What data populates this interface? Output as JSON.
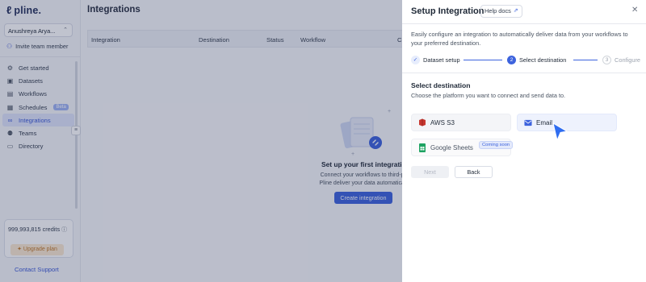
{
  "brand": {
    "logo_text": "pline."
  },
  "sidebar": {
    "account_name": "Anushreya Arya...",
    "invite_label": "Invite team member",
    "items": [
      {
        "label": "Get started",
        "icon": "rocket-icon"
      },
      {
        "label": "Datasets",
        "icon": "datasets-icon"
      },
      {
        "label": "Workflows",
        "icon": "workflows-icon"
      },
      {
        "label": "Schedules",
        "icon": "calendar-icon",
        "badge": "Beta"
      },
      {
        "label": "Integrations",
        "icon": "link-icon",
        "active": true
      },
      {
        "label": "Teams",
        "icon": "users-icon"
      },
      {
        "label": "Directory",
        "icon": "folder-icon"
      }
    ],
    "credits": "999,993,815 credits",
    "upgrade_label": "Upgrade plan",
    "support_label": "Contact Support"
  },
  "main": {
    "title": "Integrations",
    "columns": [
      "Integration",
      "Destination",
      "Status",
      "Workflow",
      "C"
    ],
    "empty_title": "Set up your first integratio",
    "empty_line1": "Connect your workflows to third-party plat",
    "empty_line2": "Pline deliver your data automatically and c",
    "create_label": "Create integration"
  },
  "drawer": {
    "title": "Setup Integration",
    "help_label": "Help docs",
    "intro": "Easily configure an integration to automatically deliver data from your workflows to your preferred destination.",
    "steps": [
      {
        "num": "✓",
        "label": "Dataset setup",
        "state": "done"
      },
      {
        "num": "2",
        "label": "Select destination",
        "state": "active"
      },
      {
        "num": "3",
        "label": "Configure",
        "state": "upcoming"
      }
    ],
    "section_title": "Select destination",
    "section_desc": "Choose the platform you want to connect and send data to.",
    "destinations": [
      {
        "label": "AWS S3",
        "icon": "aws-s3-icon"
      },
      {
        "label": "Email",
        "icon": "mail-icon",
        "selected": true
      },
      {
        "label": "Google Sheets",
        "icon": "google-sheets-icon",
        "badge": "Coming soon"
      }
    ],
    "next_label": "Next",
    "back_label": "Back"
  },
  "colors": {
    "accent": "#3d63dd",
    "upgrade_bg": "#fbe9d2",
    "aws": "#c7372f",
    "sheets": "#1ea362"
  }
}
